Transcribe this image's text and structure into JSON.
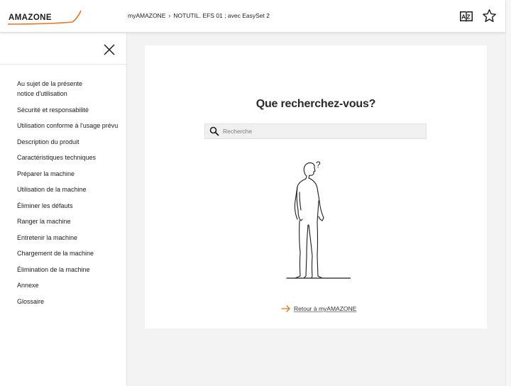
{
  "header": {
    "brand": "AMAZONE",
    "breadcrumb": [
      "myAMAZONE",
      "NOTUTIL. EFS 01 ; avec EasySet 2"
    ],
    "dictionary_icon_letters": "AZ",
    "icons": [
      "amazone-logo",
      "book-icon",
      "star-icon"
    ]
  },
  "sidebar": {
    "items": [
      "Au sujet de la présente notice d'utilisation",
      "Sécurité et responsabilité",
      "Utilisation conforme à l'usage prévu",
      "Description du produit",
      "Caractéristiques techniques",
      "Préparer la machine",
      "Utilisation de la machine",
      "Éliminer les défauts",
      "Ranger la machine",
      "Entretenir la machine",
      "Chargement de la machine",
      "Élimination de la machine",
      "Annexe",
      "Glossaire"
    ]
  },
  "main": {
    "title": "Que recherchez-vous?",
    "search_placeholder": "Recherche",
    "search_value": "",
    "question_mark": "?",
    "back_link": "Retour à myAMAZONE"
  },
  "colors": {
    "accent_orange": "#e8741c",
    "text": "#1c1c1c",
    "background": "#f3f3f3"
  }
}
